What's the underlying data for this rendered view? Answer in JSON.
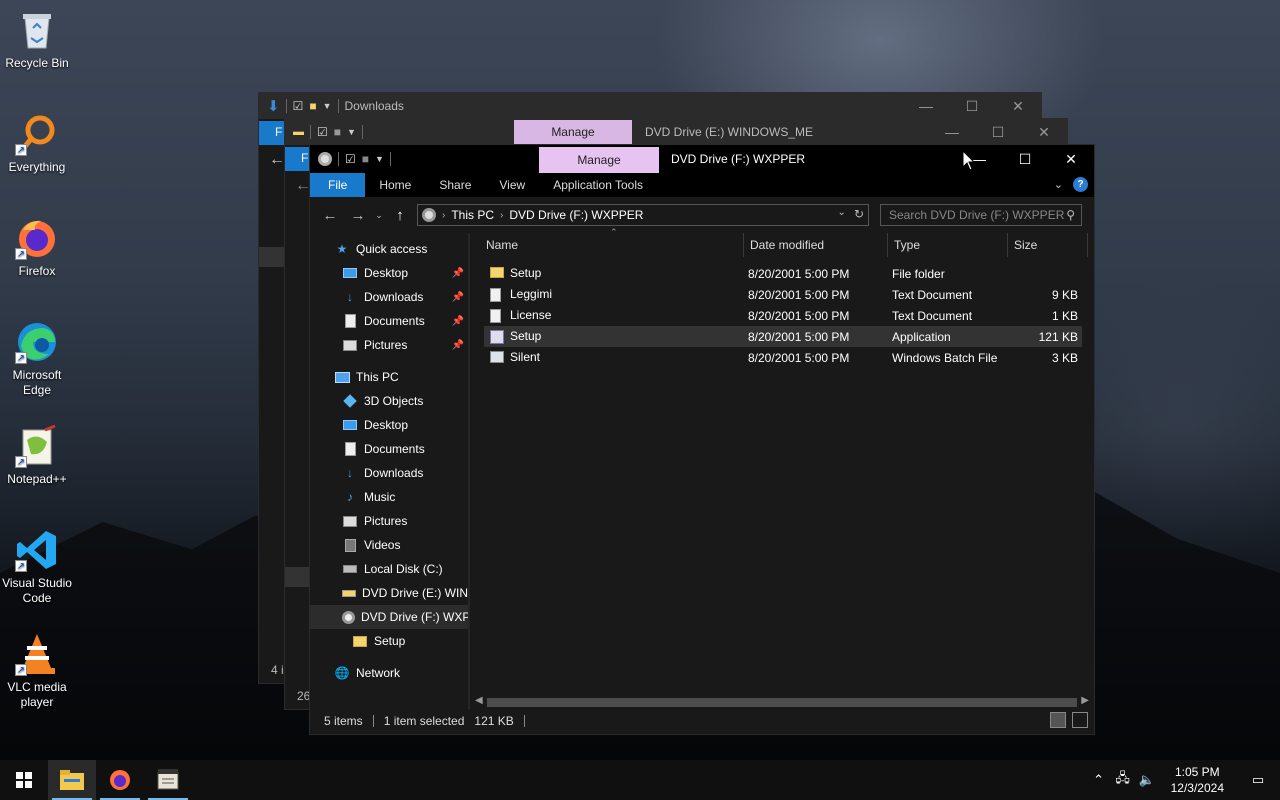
{
  "desktop": {
    "icons": [
      {
        "label": "Recycle Bin",
        "icon": "recycle-bin-icon"
      },
      {
        "label": "Everything",
        "icon": "everything-icon"
      },
      {
        "label": "Firefox",
        "icon": "firefox-icon"
      },
      {
        "label": "Microsoft Edge",
        "icon": "edge-icon"
      },
      {
        "label": "Notepad++",
        "icon": "notepadpp-icon"
      },
      {
        "label": "Visual Studio Code",
        "icon": "vscode-icon"
      },
      {
        "label": "VLC media player",
        "icon": "vlc-icon"
      }
    ]
  },
  "back_window_1": {
    "title": "Downloads",
    "ribbon_file_partial": "F",
    "status_partial": "4 i"
  },
  "back_window_2": {
    "title": "DVD Drive (E:) WINDOWS_ME",
    "manage_label": "Manage",
    "ribbon_file_partial": "F",
    "status_partial": "26"
  },
  "explorer": {
    "title": "DVD Drive (F:) WXPPER",
    "manage_label": "Manage",
    "ribbon_tabs": [
      "File",
      "Home",
      "Share",
      "View",
      "Application Tools"
    ],
    "address": {
      "crumbs": [
        "This PC",
        "DVD Drive (F:) WXPPER"
      ]
    },
    "search_placeholder": "Search DVD Drive (F:) WXPPER",
    "nav": [
      {
        "label": "Quick access",
        "icon": "star-icon",
        "indent": 0,
        "pinned": false
      },
      {
        "label": "Desktop",
        "icon": "desktop-icon",
        "indent": 1,
        "pinned": true
      },
      {
        "label": "Downloads",
        "icon": "download-icon",
        "indent": 1,
        "pinned": true
      },
      {
        "label": "Documents",
        "icon": "document-icon",
        "indent": 1,
        "pinned": true
      },
      {
        "label": "Pictures",
        "icon": "picture-icon",
        "indent": 1,
        "pinned": true
      },
      {
        "label": "This PC",
        "icon": "computer-icon",
        "indent": 0,
        "pinned": false
      },
      {
        "label": "3D Objects",
        "icon": "cube-icon",
        "indent": 1,
        "pinned": false
      },
      {
        "label": "Desktop",
        "icon": "desktop-icon",
        "indent": 1,
        "pinned": false
      },
      {
        "label": "Documents",
        "icon": "document-icon",
        "indent": 1,
        "pinned": false
      },
      {
        "label": "Downloads",
        "icon": "download-icon",
        "indent": 1,
        "pinned": false
      },
      {
        "label": "Music",
        "icon": "music-icon",
        "indent": 1,
        "pinned": false
      },
      {
        "label": "Pictures",
        "icon": "picture-icon",
        "indent": 1,
        "pinned": false
      },
      {
        "label": "Videos",
        "icon": "video-icon",
        "indent": 1,
        "pinned": false
      },
      {
        "label": "Local Disk (C:)",
        "icon": "disk-icon",
        "indent": 1,
        "pinned": false
      },
      {
        "label": "DVD Drive (E:) WIND",
        "icon": "dvd-icon",
        "indent": 1,
        "pinned": false
      },
      {
        "label": "DVD Drive (F:) WXPI",
        "icon": "disc-icon",
        "indent": 1,
        "pinned": false,
        "selected": true
      },
      {
        "label": "Setup",
        "icon": "folder-icon",
        "indent": 2,
        "pinned": false
      },
      {
        "label": "Network",
        "icon": "network-icon",
        "indent": 0,
        "pinned": false
      }
    ],
    "columns": [
      "Name",
      "Date modified",
      "Type",
      "Size"
    ],
    "files": [
      {
        "name": "Setup",
        "date": "8/20/2001 5:00 PM",
        "type": "File folder",
        "size": "",
        "icon": "folder-icon"
      },
      {
        "name": "Leggimi",
        "date": "8/20/2001 5:00 PM",
        "type": "Text Document",
        "size": "9 KB",
        "icon": "text-file-icon"
      },
      {
        "name": "License",
        "date": "8/20/2001 5:00 PM",
        "type": "Text Document",
        "size": "1 KB",
        "icon": "text-file-icon"
      },
      {
        "name": "Setup",
        "date": "8/20/2001 5:00 PM",
        "type": "Application",
        "size": "121 KB",
        "icon": "application-icon",
        "selected": true
      },
      {
        "name": "Silent",
        "date": "8/20/2001 5:00 PM",
        "type": "Windows Batch File",
        "size": "3 KB",
        "icon": "batch-file-icon"
      }
    ],
    "status": {
      "items": "5 items",
      "selected": "1 item selected",
      "size": "121 KB"
    }
  },
  "taskbar": {
    "apps": [
      "file-explorer-icon",
      "firefox-icon",
      "media-icon"
    ],
    "time": "1:05 PM",
    "date": "12/3/2024"
  }
}
